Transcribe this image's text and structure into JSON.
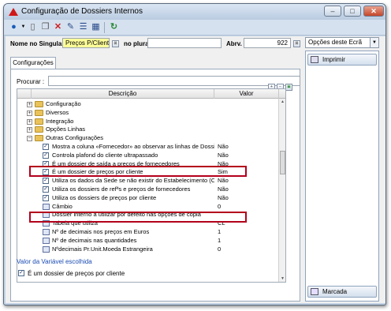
{
  "window": {
    "title": "Configuração de Dossiers Internos"
  },
  "toolbar_icons": [
    "dropdown-icon",
    "new-document-icon",
    "copy-icon",
    "delete-icon",
    "properties-icon",
    "list-icon",
    "grid-icon",
    "refresh-icon"
  ],
  "header": {
    "nome_label": "Nome no Singular",
    "nome_value": "Preços P/Cliente",
    "plural_label": "no plural",
    "plural_value": "",
    "abrv_label": "Abrv.",
    "abrv_value": "922"
  },
  "side": {
    "combo_value": "Opções deste Ecrã",
    "print_label": "Imprimir",
    "marcada_label": "Marcada"
  },
  "tabs": [
    {
      "label": "Configurações"
    }
  ],
  "search": {
    "label": "Procurar :",
    "value": ""
  },
  "grid": {
    "columns": {
      "descricao": "Descrição",
      "valor": "Valor"
    },
    "rows": [
      {
        "text": "Configuração",
        "value": ""
      },
      {
        "text": "Diversos",
        "value": ""
      },
      {
        "text": "Integração",
        "value": ""
      },
      {
        "text": "Opções Linhas",
        "value": ""
      },
      {
        "text": "Outras Configurações",
        "value": ""
      },
      {
        "text": "Mostra a coluna «Fornecedor» ao observar as linhas de Dossiers a p...",
        "value": "Não"
      },
      {
        "text": "Controla plafond do cliente ultrapassado",
        "value": "Não"
      },
      {
        "text": "É um dossier de saída a preços de fornecedores",
        "value": "Não"
      },
      {
        "text": "É um dossier de preços por cliente",
        "value": "Sim"
      },
      {
        "text": "Utiliza os dados da Sede se não existir do Estabelecimento (Condim Clientes)",
        "value": "Não"
      },
      {
        "text": "Utiliza os dossiers de refªs e preços de fornecedores",
        "value": "Não"
      },
      {
        "text": "Utiliza os dossiers de preços por cliente",
        "value": "Não"
      },
      {
        "text": "Câmbio",
        "value": "0"
      },
      {
        "text": "Dossier interno a utilizar por defeito nas opções de cópia",
        "value": ""
      },
      {
        "text": "Tabela que utiliza",
        "value": "CL"
      },
      {
        "text": "Nº de decimais nos preços em Euros",
        "value": "1"
      },
      {
        "text": "Nº de decimais nas quantidades",
        "value": "1"
      },
      {
        "text": "Nºdecimais Pr.Unit.Moeda Estrangeira",
        "value": "0"
      }
    ]
  },
  "footer": {
    "variable_label": "Valor da Variável escolhida",
    "variable_value": "É um dossier de preços por cliente"
  },
  "colors": {
    "highlight": "#b3001b",
    "name_field": "#ffff99",
    "link_text": "#1a4bb3"
  }
}
